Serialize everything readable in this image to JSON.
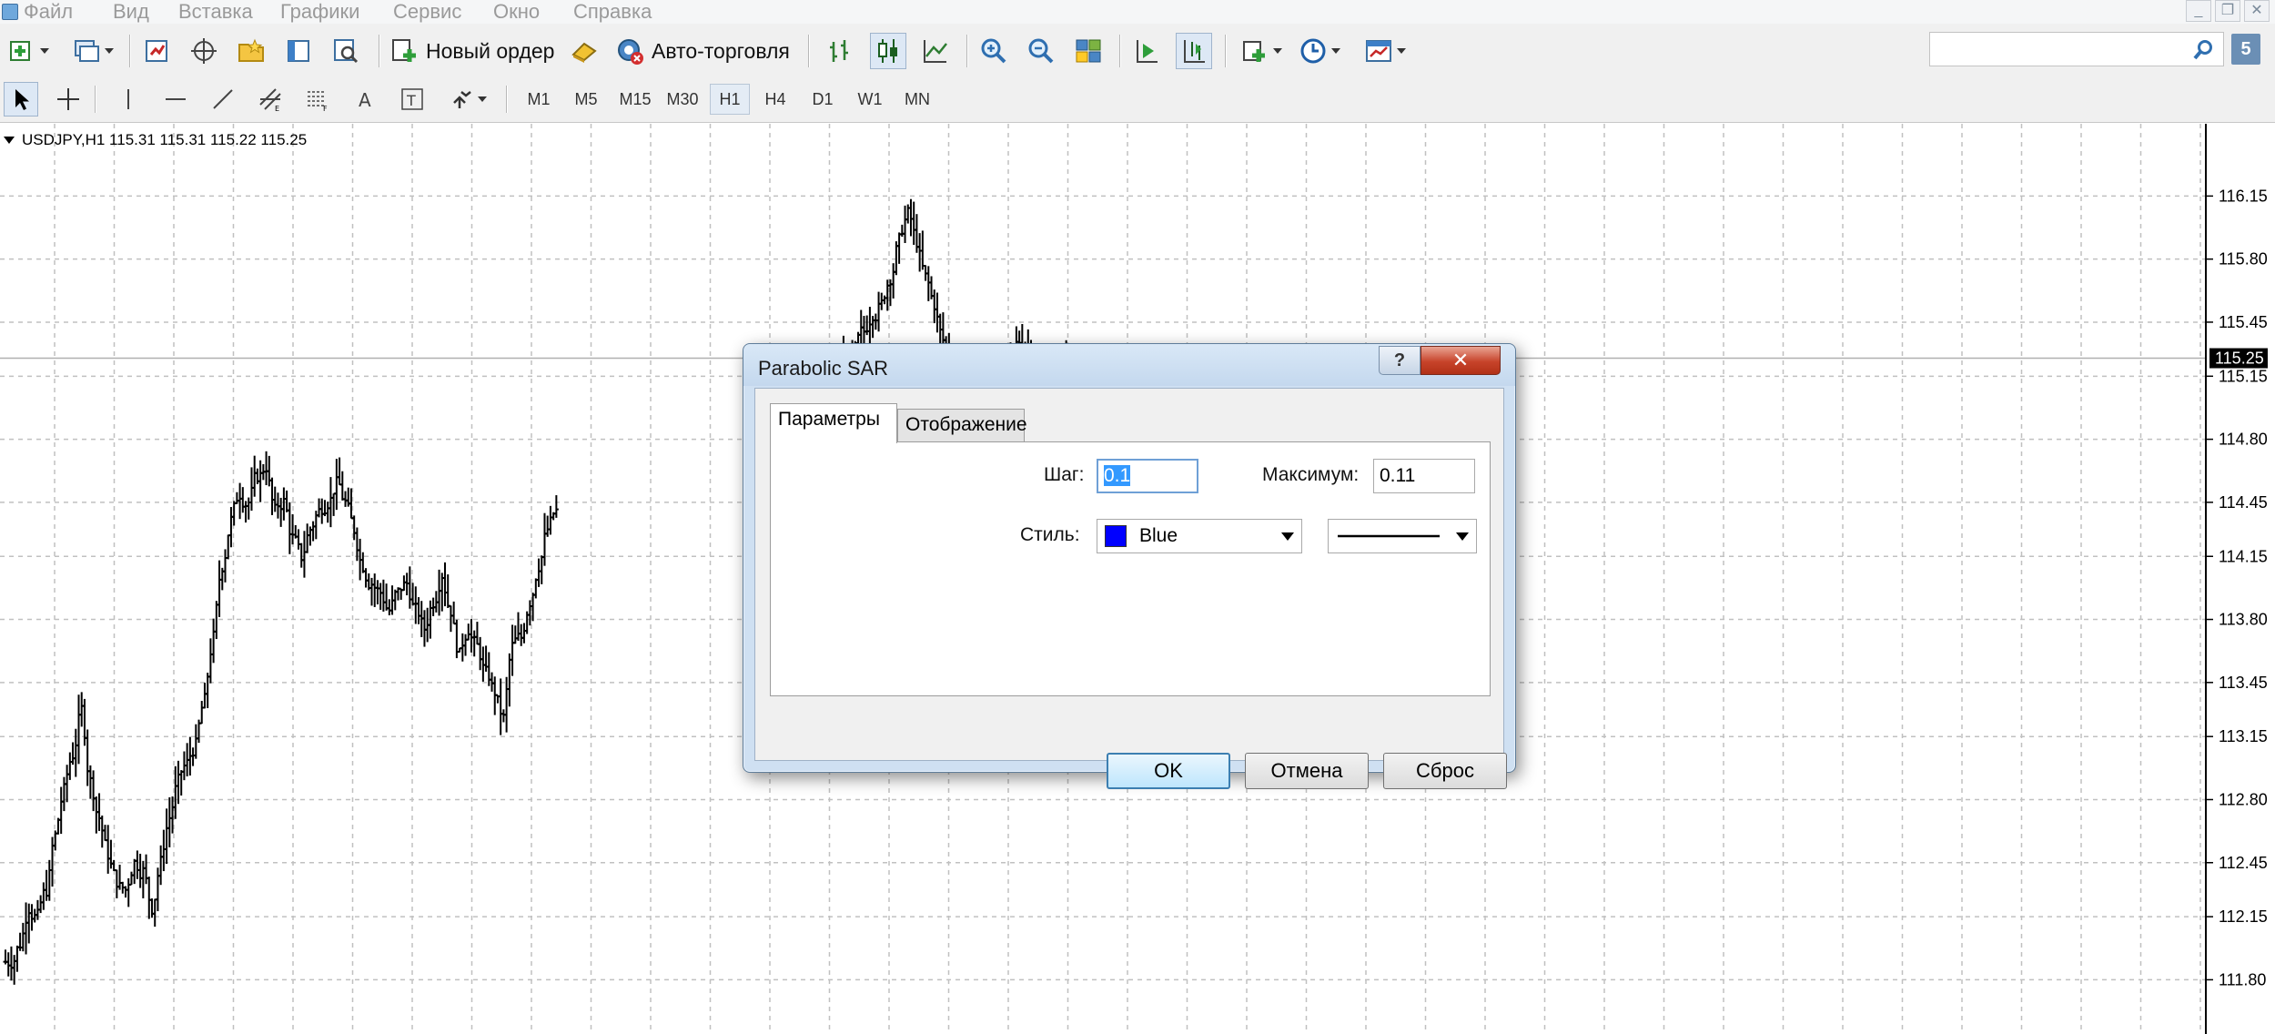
{
  "menu": {
    "items": [
      "Файл",
      "Вид",
      "Вставка",
      "Графики",
      "Сервис",
      "Окно",
      "Справка"
    ],
    "window_controls": [
      "_",
      "❐",
      "✕"
    ]
  },
  "toolbar": {
    "new_order_label": "Новый ордер",
    "autotrading_label": "Авто-торговля",
    "search_value": "",
    "notifications_count": "5"
  },
  "timeframes": [
    "M1",
    "M5",
    "M15",
    "M30",
    "H1",
    "H4",
    "D1",
    "W1",
    "MN"
  ],
  "active_timeframe": "H1",
  "chart": {
    "header": "USDJPY,H1  115.31  115.31  115.22  115.25",
    "current_price_label": "115.25",
    "colors": {
      "background": "#ffffff",
      "grid": "#c0c0c0",
      "bars": "#000000",
      "price_line": "#b0b0b0",
      "price_label_bg": "#000000"
    }
  },
  "chart_data": {
    "type": "ohlc",
    "symbol": "USDJPY",
    "timeframe": "H1",
    "last_bar": {
      "open": 115.31,
      "high": 115.31,
      "low": 115.22,
      "close": 115.25
    },
    "current_price": 115.25,
    "y_ticks": [
      "116.15",
      "115.80",
      "115.45",
      "115.15",
      "114.80",
      "114.45",
      "114.15",
      "113.80",
      "113.45",
      "113.15",
      "112.80",
      "112.45",
      "112.15",
      "111.80"
    ],
    "ylim": [
      111.6,
      116.45
    ],
    "grid": true,
    "close_series_segments": [
      {
        "start_bar": 0,
        "closes": [
          111.9,
          112.0,
          112.2,
          112.15,
          112.3,
          112.6,
          112.85,
          113.05,
          113.3,
          112.9,
          112.7,
          112.5,
          112.35,
          112.3,
          112.45,
          112.4,
          112.2,
          112.45,
          112.7,
          112.9,
          113.0,
          113.1,
          113.35,
          113.7,
          114.1,
          114.35,
          114.5,
          114.45,
          114.6,
          114.65,
          114.4,
          114.45,
          114.25,
          114.15,
          114.3,
          114.4,
          114.45,
          114.55,
          114.45,
          114.3,
          114.1,
          114.0,
          113.95,
          113.85,
          113.95,
          114.0,
          113.85,
          113.75,
          113.9,
          114.05,
          113.85,
          113.6,
          113.75,
          113.65,
          113.5,
          113.4,
          113.25,
          113.65,
          113.7,
          113.9,
          114.1,
          114.3,
          114.4
        ]
      },
      {
        "start_bar": 94,
        "closes": [
          115.2,
          115.25,
          115.3,
          115.4,
          115.5,
          115.55,
          115.7,
          115.9,
          116.05,
          115.9,
          115.7,
          115.55,
          115.35,
          115.2,
          115.05,
          114.95,
          114.9,
          115.0,
          115.1,
          115.2,
          115.3,
          115.35,
          115.3,
          115.2,
          115.1,
          115.2,
          115.25
        ]
      }
    ]
  },
  "dialog": {
    "title": "Parabolic SAR",
    "help_label": "?",
    "close_label": "✕",
    "tabs": [
      "Параметры",
      "Отображение"
    ],
    "active_tab": "Параметры",
    "step_label": "Шаг:",
    "step_value": "0.1",
    "max_label": "Максимум:",
    "max_value": "0.11",
    "style_label": "Стиль:",
    "color_name": "Blue",
    "color_hex": "#0000ff",
    "ok_label": "OK",
    "cancel_label": "Отмена",
    "reset_label": "Сброс"
  }
}
